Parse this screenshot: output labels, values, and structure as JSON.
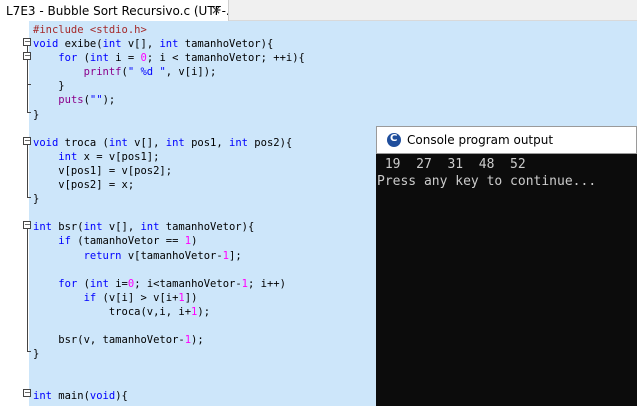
{
  "tab": {
    "label": "L7E3 - Bubble Sort Recursivo.c (UTF-...",
    "close_glyph": "×"
  },
  "code_lines": [
    [
      {
        "t": "#include <stdio.h>",
        "c": "pp"
      }
    ],
    [
      {
        "t": "void",
        "c": "kw"
      },
      {
        "t": " exibe("
      },
      {
        "t": "int",
        "c": "kw"
      },
      {
        "t": " v[], "
      },
      {
        "t": "int",
        "c": "kw"
      },
      {
        "t": " tamanhoVetor){"
      }
    ],
    [
      {
        "t": "    "
      },
      {
        "t": "for",
        "c": "kw"
      },
      {
        "t": " ("
      },
      {
        "t": "int",
        "c": "kw"
      },
      {
        "t": " i = "
      },
      {
        "t": "0",
        "c": "num"
      },
      {
        "t": "; i < tamanhoVetor; ++i){"
      }
    ],
    [
      {
        "t": "        "
      },
      {
        "t": "printf",
        "c": "fn"
      },
      {
        "t": "("
      },
      {
        "t": "\" %d \"",
        "c": "str"
      },
      {
        "t": ", v[i]);"
      }
    ],
    [
      {
        "t": "    }"
      }
    ],
    [
      {
        "t": "    "
      },
      {
        "t": "puts",
        "c": "fn"
      },
      {
        "t": "("
      },
      {
        "t": "\"\"",
        "c": "str"
      },
      {
        "t": ");"
      }
    ],
    [
      {
        "t": "}"
      }
    ],
    [
      {
        "t": ""
      }
    ],
    [
      {
        "t": "void",
        "c": "kw"
      },
      {
        "t": " troca ("
      },
      {
        "t": "int",
        "c": "kw"
      },
      {
        "t": " v[], "
      },
      {
        "t": "int",
        "c": "kw"
      },
      {
        "t": " pos1, "
      },
      {
        "t": "int",
        "c": "kw"
      },
      {
        "t": " pos2){"
      }
    ],
    [
      {
        "t": "    "
      },
      {
        "t": "int",
        "c": "kw"
      },
      {
        "t": " x = v[pos1];"
      }
    ],
    [
      {
        "t": "    v[pos1] = v[pos2];"
      }
    ],
    [
      {
        "t": "    v[pos2] = x;"
      }
    ],
    [
      {
        "t": "}"
      }
    ],
    [
      {
        "t": ""
      }
    ],
    [
      {
        "t": "int",
        "c": "kw"
      },
      {
        "t": " bsr("
      },
      {
        "t": "int",
        "c": "kw"
      },
      {
        "t": " v[], "
      },
      {
        "t": "int",
        "c": "kw"
      },
      {
        "t": " tamanhoVetor){"
      }
    ],
    [
      {
        "t": "    "
      },
      {
        "t": "if",
        "c": "kw"
      },
      {
        "t": " (tamanhoVetor == "
      },
      {
        "t": "1",
        "c": "num"
      },
      {
        "t": ")"
      }
    ],
    [
      {
        "t": "        "
      },
      {
        "t": "return",
        "c": "kw"
      },
      {
        "t": " v[tamanhoVetor-"
      },
      {
        "t": "1",
        "c": "num"
      },
      {
        "t": "];"
      }
    ],
    [
      {
        "t": ""
      }
    ],
    [
      {
        "t": "    "
      },
      {
        "t": "for",
        "c": "kw"
      },
      {
        "t": " ("
      },
      {
        "t": "int",
        "c": "kw"
      },
      {
        "t": " i="
      },
      {
        "t": "0",
        "c": "num"
      },
      {
        "t": "; i<tamanhoVetor-"
      },
      {
        "t": "1",
        "c": "num"
      },
      {
        "t": "; i++)"
      }
    ],
    [
      {
        "t": "        "
      },
      {
        "t": "if",
        "c": "kw"
      },
      {
        "t": " (v[i] > v[i+"
      },
      {
        "t": "1",
        "c": "num"
      },
      {
        "t": "])"
      }
    ],
    [
      {
        "t": "            troca(v,i, i+"
      },
      {
        "t": "1",
        "c": "num"
      },
      {
        "t": ");"
      }
    ],
    [
      {
        "t": ""
      }
    ],
    [
      {
        "t": "    bsr(v, tamanhoVetor-"
      },
      {
        "t": "1",
        "c": "num"
      },
      {
        "t": ");"
      }
    ],
    [
      {
        "t": "}"
      }
    ],
    [
      {
        "t": ""
      }
    ],
    [
      {
        "t": ""
      }
    ],
    [
      {
        "t": "int",
        "c": "kw"
      },
      {
        "t": " main("
      },
      {
        "t": "void",
        "c": "kw"
      },
      {
        "t": "){"
      }
    ]
  ],
  "fold_symbols": {
    "collapse": "−"
  },
  "console": {
    "title": "Console program output",
    "line1": " 19  27  31  48  52",
    "line2": "Press any key to continue..."
  }
}
